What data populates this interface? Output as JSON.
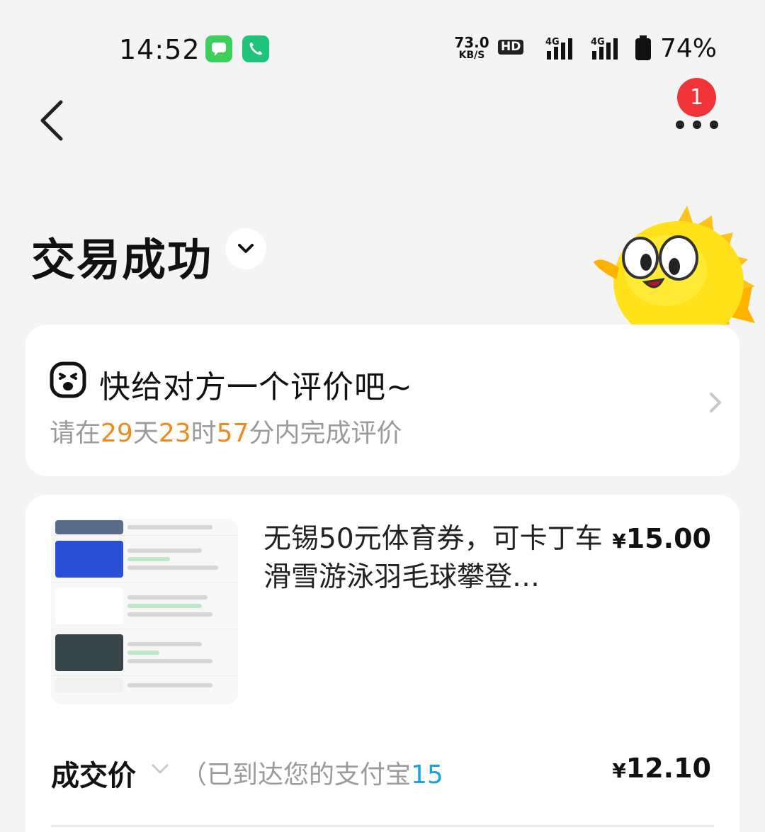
{
  "status_bar": {
    "time": "14:52",
    "net_speed_value": "73.0",
    "net_speed_unit": "KB/S",
    "hd_label": "HD",
    "signal_1": "4G",
    "signal_2": "4G",
    "battery": "74%"
  },
  "header": {
    "notification_count": "1"
  },
  "order": {
    "status": "交易成功"
  },
  "review": {
    "title": "快给对方一个评价吧~",
    "deadline_prefix": "请在",
    "days": "29",
    "days_unit": "天",
    "hours": "23",
    "hours_unit": "时",
    "minutes": "57",
    "minutes_unit": "分内完成评价"
  },
  "product": {
    "title": "无锡50元体育券，可卡丁车滑雪游泳羽毛球攀登…",
    "price_symbol": "¥",
    "price": "15.00"
  },
  "deal": {
    "label": "成交价",
    "note_prefix": "（已到达您的支付宝",
    "note_account": "15",
    "price_symbol": "¥",
    "price": "12.10"
  },
  "colors": {
    "background": "#f4f4f4",
    "accent_orange": "#f0891e",
    "badge_red": "#f0343a",
    "link_blue": "#1aa0e8"
  }
}
